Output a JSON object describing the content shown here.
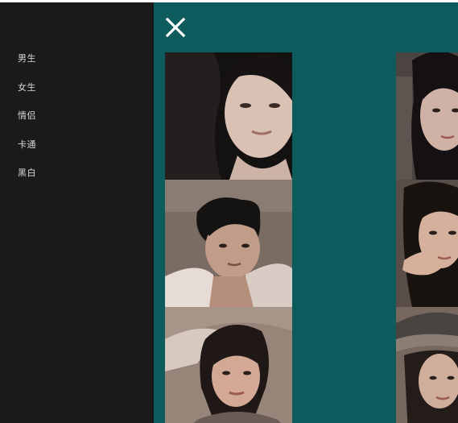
{
  "sidebar": {
    "items": [
      {
        "label": "男生",
        "icon": "none"
      },
      {
        "label": "女生",
        "icon": "none"
      },
      {
        "label": "情侣",
        "icon": "none"
      },
      {
        "label": "卡通",
        "icon": "none"
      },
      {
        "label": "黑白",
        "icon": "none"
      }
    ]
  },
  "panel": {
    "close_icon": "close-icon",
    "colors": {
      "background": "#0d5b5c",
      "sidebar": "#1b1a1b"
    },
    "photos_left": [
      {
        "subject": "woman-portrait-dark"
      },
      {
        "subject": "man-portrait-messy-hair"
      },
      {
        "subject": "woman-portrait-hand-on-head"
      }
    ],
    "photos_right": [
      {
        "subject": "woman-portrait-bangs"
      },
      {
        "subject": "woman-portrait-hand-on-chin"
      },
      {
        "subject": "woman-portrait-hat"
      }
    ]
  }
}
